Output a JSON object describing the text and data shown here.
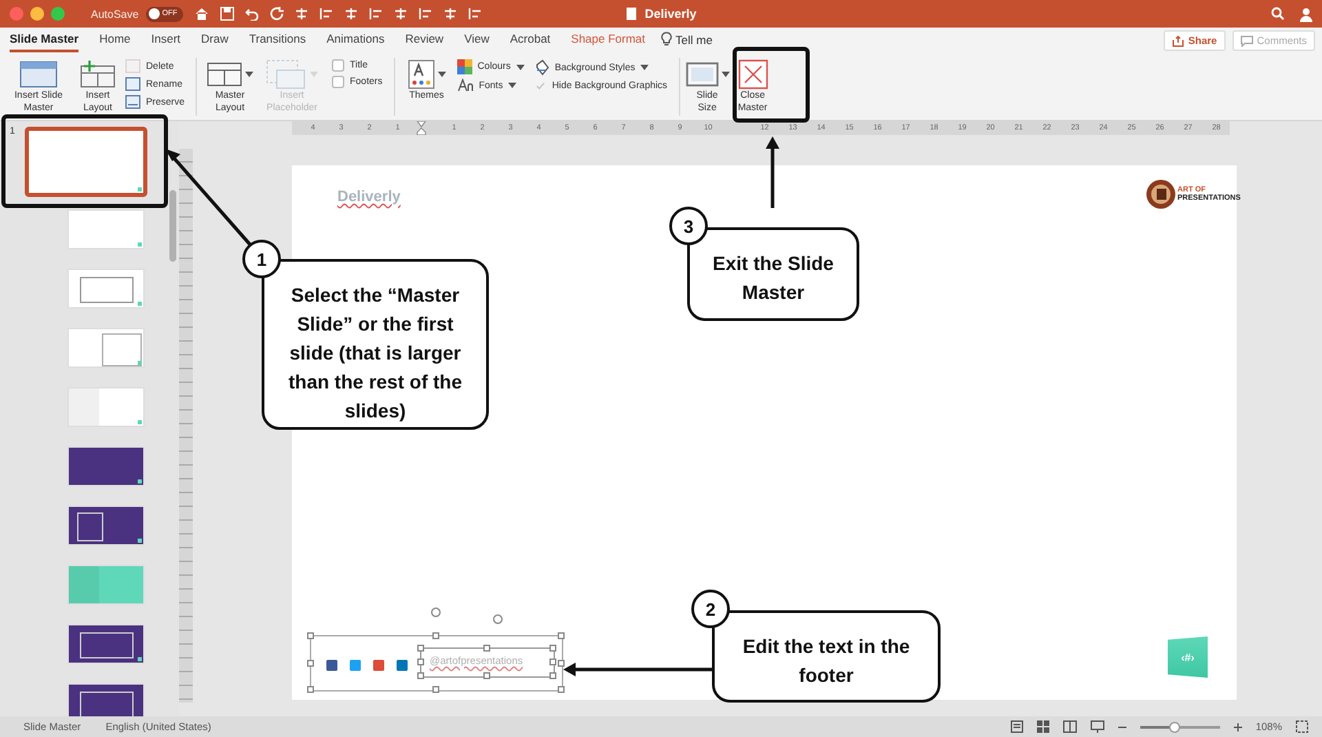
{
  "window": {
    "title": "Deliverly",
    "autosave": {
      "label": "AutoSave",
      "on": false,
      "state_text": "OFF"
    }
  },
  "tabs": [
    {
      "label": "Slide Master",
      "selected": true,
      "kind": "normal"
    },
    {
      "label": "Home",
      "selected": false,
      "kind": "normal"
    },
    {
      "label": "Insert",
      "selected": false,
      "kind": "normal"
    },
    {
      "label": "Draw",
      "selected": false,
      "kind": "normal"
    },
    {
      "label": "Transitions",
      "selected": false,
      "kind": "normal"
    },
    {
      "label": "Animations",
      "selected": false,
      "kind": "normal"
    },
    {
      "label": "Review",
      "selected": false,
      "kind": "normal"
    },
    {
      "label": "View",
      "selected": false,
      "kind": "normal"
    },
    {
      "label": "Acrobat",
      "selected": false,
      "kind": "normal"
    },
    {
      "label": "Shape Format",
      "selected": false,
      "kind": "contextual"
    }
  ],
  "tell_me": "Tell me",
  "share": "Share",
  "comments": "Comments",
  "ribbon": [
    {
      "items": [
        {
          "kind": "large",
          "label": "Insert Slide Master",
          "dropdown": false,
          "disabled": false
        },
        {
          "kind": "large",
          "label": "Insert Layout",
          "dropdown": false,
          "disabled": false
        },
        {
          "kind": "stack",
          "rows": [
            {
              "kind": "button",
              "label": "Delete",
              "dropdown": false,
              "disabled": true
            },
            {
              "kind": "button",
              "label": "Rename",
              "dropdown": false,
              "disabled": false
            },
            {
              "kind": "button",
              "label": "Preserve",
              "dropdown": false,
              "disabled": false
            }
          ]
        }
      ]
    },
    {
      "items": [
        {
          "kind": "large",
          "label": "Master Layout",
          "dropdown": true,
          "disabled": false
        },
        {
          "kind": "large",
          "label": "Insert Placeholder",
          "dropdown": true,
          "disabled": true
        },
        {
          "kind": "stack",
          "rows": [
            {
              "kind": "checkbox",
              "label": "Title",
              "checked": false
            },
            {
              "kind": "checkbox",
              "label": "Footers",
              "checked": false
            }
          ]
        }
      ]
    },
    {
      "items": [
        {
          "kind": "large",
          "label": "Themes",
          "dropdown": true,
          "disabled": false
        },
        {
          "kind": "stack",
          "rows": [
            {
              "kind": "button",
              "label": "Colours",
              "dropdown": true,
              "disabled": false
            },
            {
              "kind": "button",
              "label": "Fonts",
              "dropdown": true,
              "disabled": false
            }
          ]
        },
        {
          "kind": "stack",
          "rows": [
            {
              "kind": "button",
              "label": "Background Styles",
              "dropdown": true,
              "disabled": false
            },
            {
              "kind": "checkbox",
              "label": "Hide Background Graphics",
              "checked": true,
              "disabled": true
            }
          ]
        }
      ]
    },
    {
      "items": [
        {
          "kind": "large",
          "label": "Slide Size",
          "dropdown": true,
          "disabled": false
        },
        {
          "kind": "large",
          "label": "Close Master",
          "dropdown": false,
          "disabled": false
        }
      ]
    }
  ],
  "ruler": {
    "segments": [
      [
        "4",
        "3",
        "2",
        "1"
      ],
      [
        "1",
        "2",
        "3",
        "4",
        "5",
        "6",
        "7",
        "8",
        "9",
        "10"
      ],
      [
        "12",
        "13",
        "14",
        "15",
        "16",
        "17",
        "18",
        "19",
        "20",
        "21",
        "22",
        "23",
        "24",
        "25",
        "26",
        "27",
        "28"
      ]
    ]
  },
  "thumbnails": [
    {
      "number": "1",
      "selected": true,
      "color": "#ffffff",
      "kind": "blank"
    },
    {
      "selected": false,
      "color": "#ffffff",
      "kind": "blank"
    },
    {
      "selected": false,
      "color": "#ffffff",
      "kind": "frame"
    },
    {
      "selected": false,
      "color": "#ffffff",
      "kind": "split"
    },
    {
      "selected": false,
      "color": "#ffffff",
      "kind": "half"
    },
    {
      "selected": false,
      "color": "#4b3280",
      "kind": "blank"
    },
    {
      "selected": false,
      "color": "#4b3280",
      "kind": "frame-left"
    },
    {
      "selected": false,
      "color": "#5ed8b8",
      "kind": "half"
    },
    {
      "selected": false,
      "color": "#4b3280",
      "kind": "frame"
    },
    {
      "selected": false,
      "color": "#4b3280",
      "kind": "frame"
    }
  ],
  "slide": {
    "title": "Deliverly",
    "logo_lines": [
      "ART OF",
      "PRESENTATIONS"
    ],
    "footer_text": "@artofpresentations",
    "slide_number": "‹#›"
  },
  "status_bar": {
    "view": "Slide Master",
    "language": "English (United States)",
    "zoom": {
      "level": 0.43,
      "reading": "108%"
    }
  },
  "callouts": [
    {
      "number": "1",
      "text": "Select the “Master Slide” or the first slide (that is larger than the rest of the slides)"
    },
    {
      "number": "3",
      "text": "Exit the Slide Master"
    },
    {
      "number": "2",
      "text": "Edit the text in the footer"
    }
  ]
}
